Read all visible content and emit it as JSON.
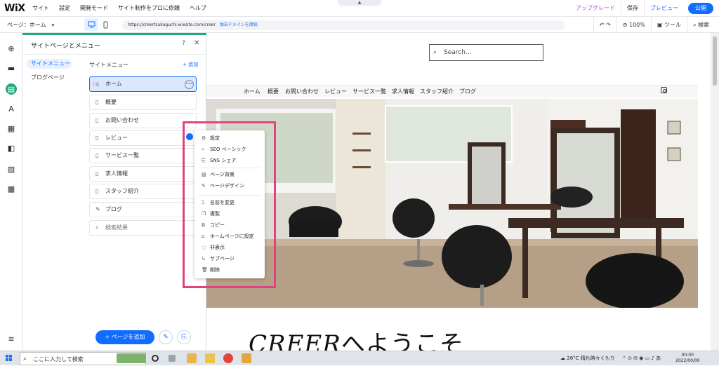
{
  "topbar": {
    "logo": "WiX",
    "menus": [
      "サイト",
      "設定",
      "開発モード",
      "サイト制作をプロに依頼",
      "ヘルプ"
    ],
    "upgrade": "アップグレード",
    "save": "保存",
    "preview": "プレビュー",
    "publish": "公開"
  },
  "bar2": {
    "page_select": "ページ：ホーム",
    "url": "https://creertsukaguchi.wixsite.com/creer",
    "connect_domain": "独自ドメインを接続",
    "zoom": "100%",
    "tools": "ツール",
    "search": "検索"
  },
  "panel": {
    "title": "サイトページとメニュー",
    "help": "?",
    "close": "✕",
    "nav_menu": "サイトメニュー",
    "nav_blog": "ブログページ",
    "section_title": "サイトメニュー",
    "add_link": "+ 追加",
    "pages": [
      "ホーム",
      "概要",
      "お問い合わせ",
      "レビュー",
      "サービス一覧",
      "求人情報",
      "スタッフ紹介",
      "ブログ",
      "検索結果"
    ],
    "add_page_button": "+ ページを追加"
  },
  "context_menu": {
    "items": [
      "設定",
      "SEO ベーシック",
      "SNS シェア",
      "ページ背景",
      "ページデザイン",
      "名前を変更",
      "複製",
      "コピー",
      "ホームページに設定",
      "非表示",
      "サブページ",
      "削除"
    ]
  },
  "site": {
    "search_placeholder": "Search...",
    "nav": [
      "ホーム",
      "概要",
      "お問い合わせ",
      "レビュー",
      "サービス一覧",
      "求人情報",
      "スタッフ紹介",
      "ブログ"
    ],
    "welcome_latin": "CREER",
    "welcome_jp": "へようこそ"
  },
  "taskbar": {
    "search": "ここに入力して検索",
    "weather": "26°C  晴れ時々くもり",
    "time": "00:00",
    "date": "2022/00/00"
  },
  "colors": {
    "accent": "#116dff",
    "editor_green": "#1ea97c",
    "highlight_pink": "#e0447f",
    "upgrade_purple": "#9a4fd8"
  }
}
